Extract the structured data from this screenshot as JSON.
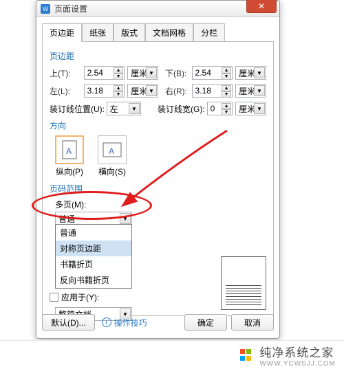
{
  "window": {
    "title": "页面设置",
    "close": "✕"
  },
  "tabs": [
    "页边距",
    "纸张",
    "版式",
    "文档网格",
    "分栏"
  ],
  "margins": {
    "title": "页边距",
    "top_label": "上(T):",
    "top": "2.54",
    "top_unit": "厘米",
    "bottom_label": "下(B):",
    "bottom": "2.54",
    "bottom_unit": "厘米",
    "left_label": "左(L):",
    "left": "3.18",
    "left_unit": "厘米",
    "right_label": "右(R):",
    "right": "3.18",
    "right_unit": "厘米",
    "gutter_pos_label": "装订线位置(U):",
    "gutter_pos": "左",
    "gutter_w_label": "装订线宽(G):",
    "gutter_w": "0",
    "gutter_w_unit": "厘米"
  },
  "orientation": {
    "title": "方向",
    "portrait": "纵向(P)",
    "landscape": "横向(S)"
  },
  "range": {
    "title": "页码范围",
    "multi_label": "多页(M):",
    "multi_value": "普通",
    "options": [
      "普通",
      "对称页边距",
      "书籍折页",
      "反向书籍折页"
    ],
    "highlight_index": 1
  },
  "apply": {
    "label": "应用于(Y):",
    "value": "整篇文档"
  },
  "buttons": {
    "default": "默认(D)...",
    "tips": "操作技巧",
    "ok": "确定",
    "cancel": "取消"
  },
  "footer": {
    "brand": "纯净系统之家",
    "sub": "WWW.YCWSJJ.COM"
  }
}
